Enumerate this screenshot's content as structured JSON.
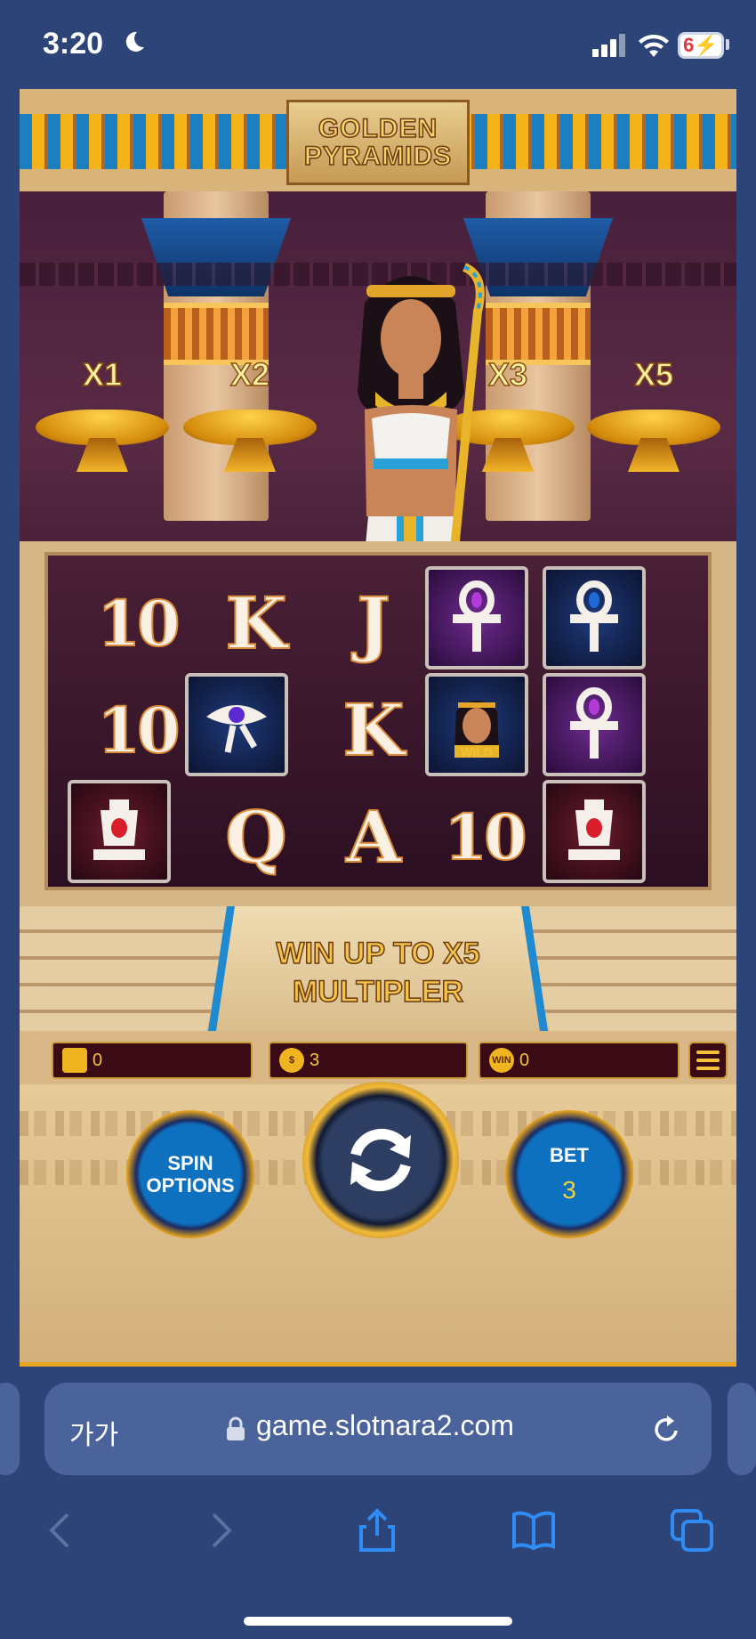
{
  "status_bar": {
    "time": "3:20",
    "battery": "6"
  },
  "game": {
    "title_line1": "GOLDEN",
    "title_line2": "PYRAMIDS",
    "multipliers": [
      "X1",
      "X2",
      "X3",
      "X5"
    ],
    "reels": [
      [
        "10",
        "K",
        "J",
        "ankh-purple",
        "ankh-blue"
      ],
      [
        "10",
        "eye-of-horus",
        "K",
        "wild",
        "ankh-purple"
      ],
      [
        "vase-red",
        "Q",
        "A",
        "10",
        "vase-red"
      ]
    ],
    "wild_label": "WILD",
    "promo_line1": "WIN UP TO X5",
    "promo_line2": "MULTIPLER",
    "hud": {
      "balance": "0",
      "coin_value": "3",
      "win_badge": "WIN",
      "win": "0"
    },
    "buttons": {
      "spin_options_line1": "SPIN",
      "spin_options_line2": "OPTIONS",
      "bet_label": "BET",
      "bet_value": "3"
    }
  },
  "browser": {
    "text_size": "가가",
    "url": "game.slotnara2.com"
  },
  "colors": {
    "accent_gold": "#f6c23a",
    "button_blue": "#0e71bf",
    "browser_bg": "#2d4478"
  }
}
